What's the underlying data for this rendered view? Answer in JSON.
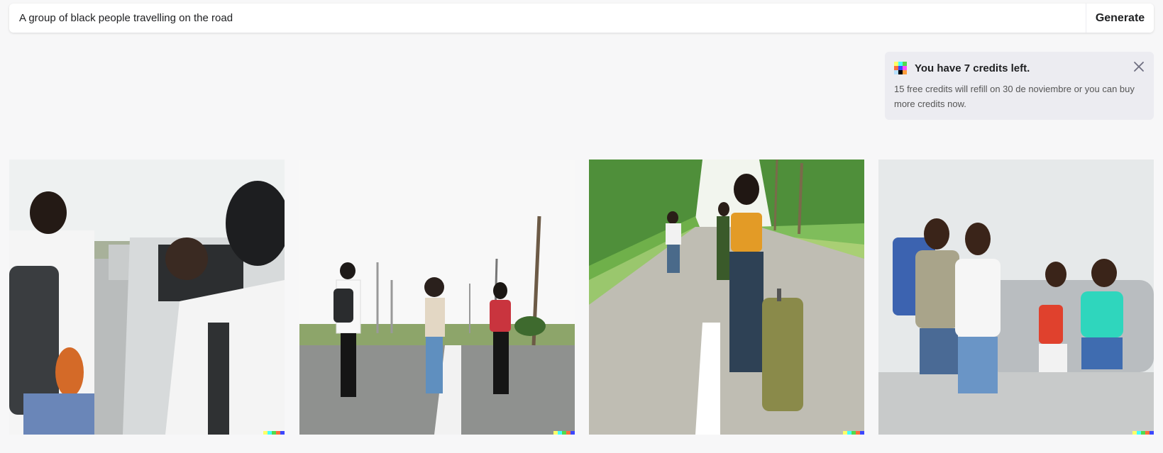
{
  "prompt": {
    "value": "A group of black people travelling on the road",
    "placeholder": "",
    "generate_label": "Generate"
  },
  "credits": {
    "title": "You have 7 credits left.",
    "body": "15 free credits will refill on 30 de noviembre or you can buy more credits now.",
    "close_icon": "close-icon",
    "logo_colors": [
      "#ffff66",
      "#42ffff",
      "#51da4c",
      "#ff6e3c",
      "#3c46ff",
      "#ff4cff",
      "#b8e0ff",
      "#000000",
      "#ff9e3c"
    ]
  },
  "watermark_colors": [
    "#ffff66",
    "#42ffff",
    "#51da4c",
    "#ff6e3c",
    "#3c46ff"
  ],
  "images": [
    {
      "description": "Women near a car on the roadside"
    },
    {
      "description": "Three people walking down a road with backpacks"
    },
    {
      "description": "Woman with suitcase standing on a green tree-lined road"
    },
    {
      "description": "Four smiling friends posing in front of a car"
    }
  ]
}
